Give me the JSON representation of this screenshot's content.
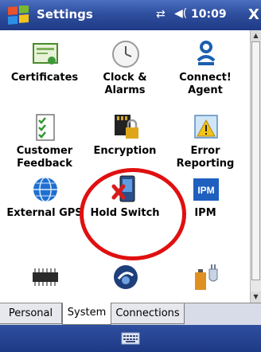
{
  "titlebar": {
    "title": "Settings",
    "time": "10:09",
    "close": "X"
  },
  "items": [
    {
      "label": "Certificates",
      "icon": "certificate-icon"
    },
    {
      "label": "Clock & Alarms",
      "icon": "clock-icon"
    },
    {
      "label": "Connect! Agent",
      "icon": "connect-agent-icon"
    },
    {
      "label": "Customer Feedback",
      "icon": "customer-feedback-icon"
    },
    {
      "label": "Encryption",
      "icon": "encryption-icon"
    },
    {
      "label": "Error Reporting",
      "icon": "error-reporting-icon"
    },
    {
      "label": "External GPS",
      "icon": "external-gps-icon"
    },
    {
      "label": "Hold Switch",
      "icon": "hold-switch-icon"
    },
    {
      "label": "IPM",
      "icon": "ipm-icon"
    }
  ],
  "tabs": {
    "personal": "Personal",
    "system": "System",
    "connections": "Connections"
  },
  "colors": {
    "titlebar": "#2f4f9f",
    "highlight": "#e01010"
  }
}
